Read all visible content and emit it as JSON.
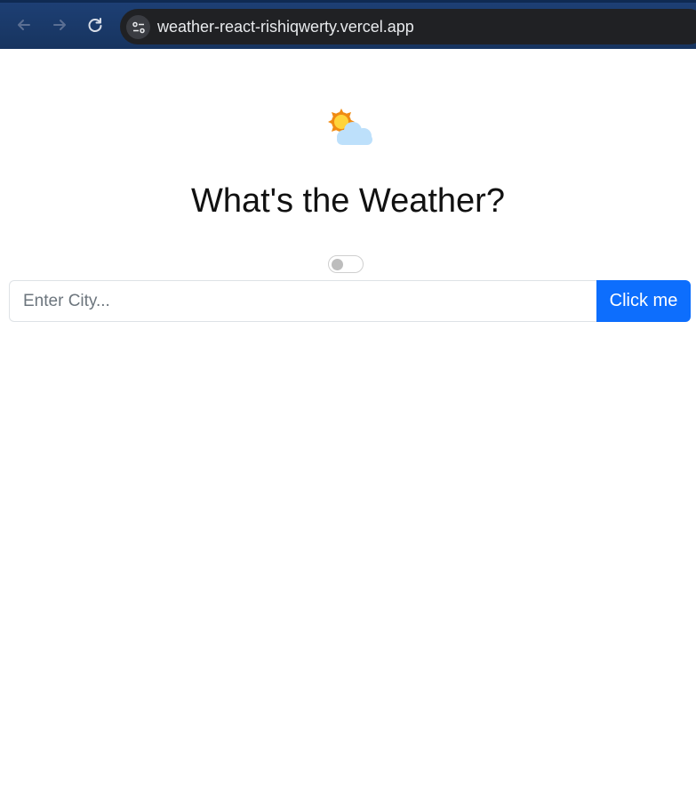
{
  "browser": {
    "url": "weather-react-rishiqwerty.vercel.app",
    "icons": {
      "back": "arrow-left-icon",
      "forward": "arrow-right-icon",
      "reload": "reload-icon",
      "site_info": "tune-icon"
    }
  },
  "app": {
    "logo_icon": "sun-behind-cloud-icon",
    "title": "What's the Weather?",
    "toggle_on": false,
    "search": {
      "placeholder": "Enter City...",
      "value": "",
      "button_label": "Click me"
    }
  },
  "colors": {
    "chrome_bg": "#17345f",
    "address_bar_bg": "#202124",
    "button_primary": "#0d6efd",
    "title_text": "#111111"
  }
}
